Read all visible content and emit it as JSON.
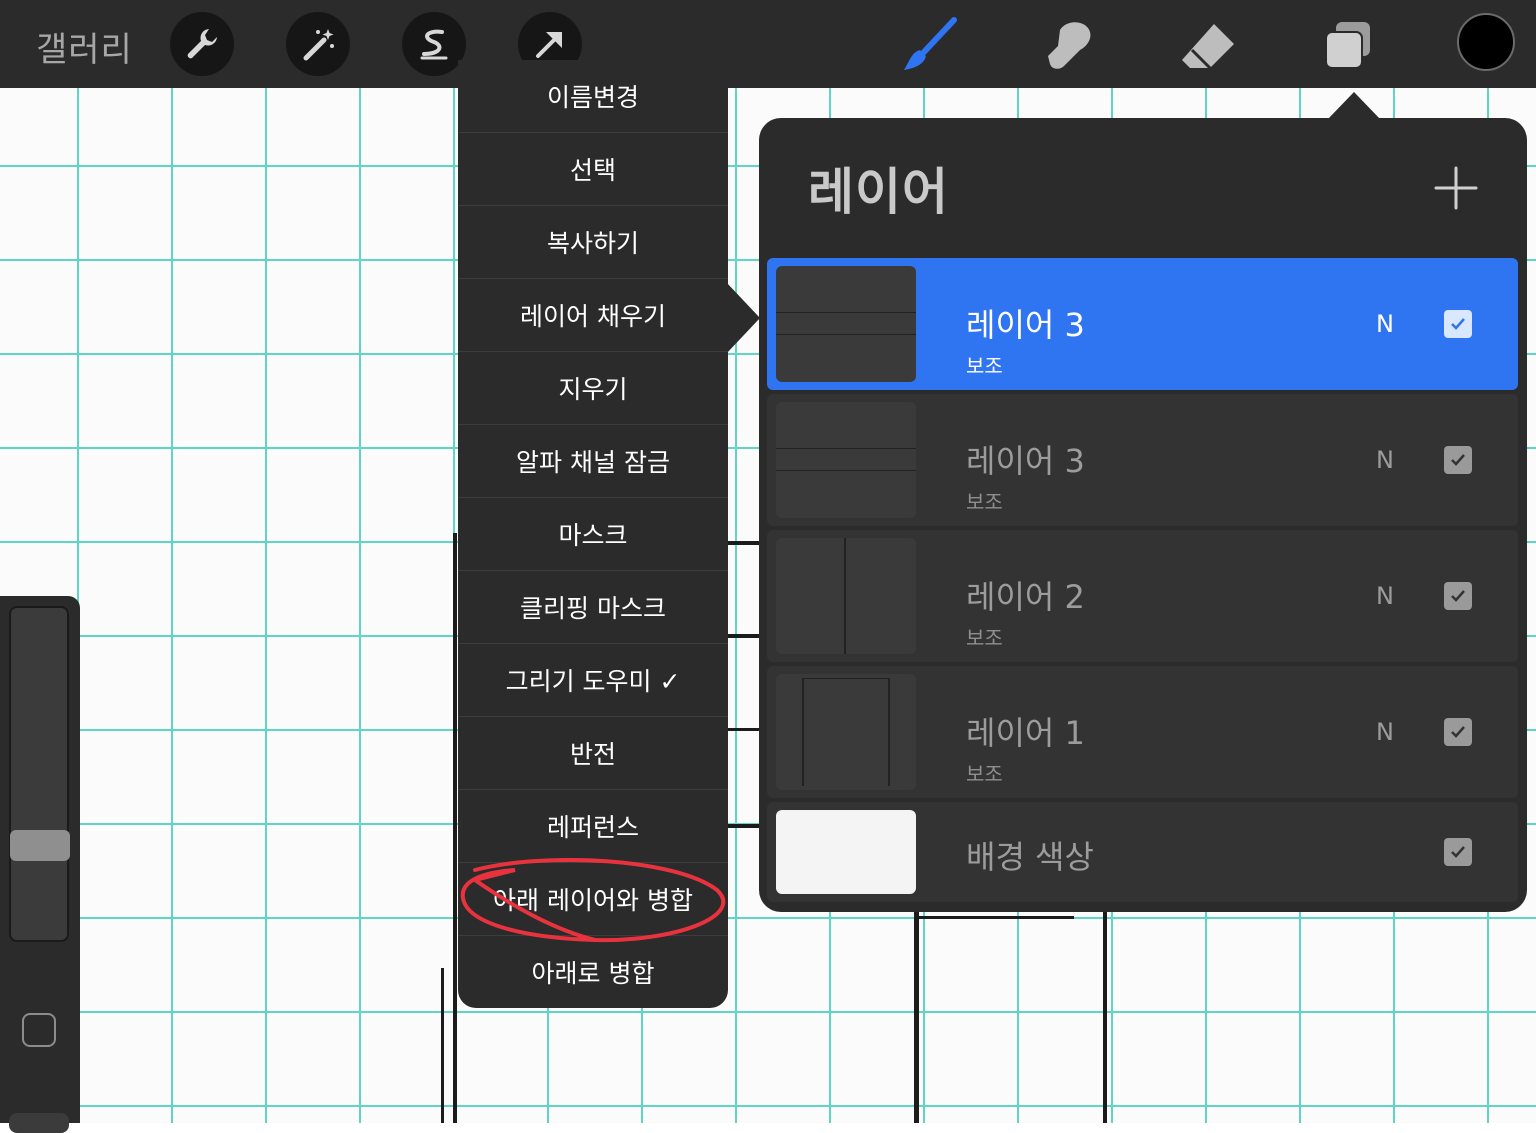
{
  "topbar": {
    "gallery_label": "갤러리",
    "tools": [
      "wrench-icon",
      "magic-wand-icon",
      "selection-icon",
      "transform-arrow-icon"
    ],
    "right_tools": [
      "brush-icon",
      "smudge-icon",
      "eraser-icon",
      "layers-icon"
    ],
    "active_tool": "brush",
    "accent_color": "#2f74f1",
    "current_color": "#000000"
  },
  "menu": {
    "items": [
      "이름변경",
      "선택",
      "복사하기",
      "레이어 채우기",
      "지우기",
      "알파 채널 잠금",
      "마스크",
      "클리핑 마스크",
      "그리기 도우미 ✓",
      "반전",
      "레퍼런스",
      "아래 레이어와 병합",
      "아래로 병합"
    ],
    "highlighted_item": "아래 레이어와 병합",
    "highlight_color": "#e8333f"
  },
  "layers": {
    "title": "레이어",
    "rows": [
      {
        "name": "레이어 3",
        "sub": "보조",
        "blend": "N",
        "visible": true,
        "active": true
      },
      {
        "name": "레이어 3",
        "sub": "보조",
        "blend": "N",
        "visible": true,
        "active": false
      },
      {
        "name": "레이어 2",
        "sub": "보조",
        "blend": "N",
        "visible": true,
        "active": false
      },
      {
        "name": "레이어 1",
        "sub": "보조",
        "blend": "N",
        "visible": true,
        "active": false
      }
    ],
    "background": {
      "name": "배경 색상",
      "visible": true
    }
  }
}
